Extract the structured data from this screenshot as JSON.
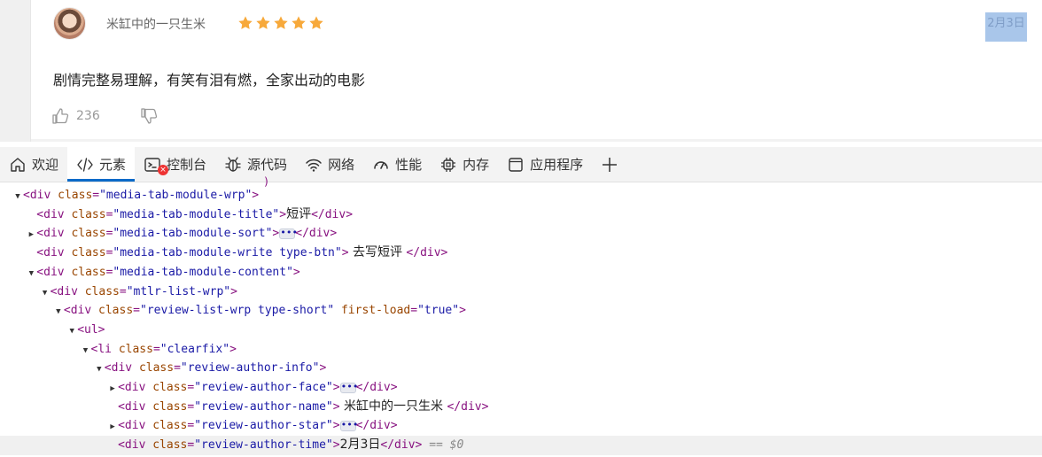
{
  "review": {
    "author_name": "米缸中的一只生米",
    "rating_stars": 5,
    "star_color": "#f7a93b",
    "date": "2月3日",
    "text": "剧情完整易理解，有笑有泪有燃，全家出动的电影",
    "like_count": "236"
  },
  "devtools": {
    "tabs": [
      {
        "label": "欢迎",
        "icon": "home-icon"
      },
      {
        "label": "元素",
        "icon": "code-icon",
        "active": true
      },
      {
        "label": "控制台",
        "icon": "console-icon",
        "badge": "x"
      },
      {
        "label": "源代码",
        "icon": "bug-icon"
      },
      {
        "label": "网络",
        "icon": "wifi-icon"
      },
      {
        "label": "性能",
        "icon": "gauge-icon"
      },
      {
        "label": "内存",
        "icon": "chip-icon"
      },
      {
        "label": "应用程序",
        "icon": "window-icon"
      }
    ],
    "add_tab_icon": "plus-icon",
    "accent_color": "#0b6ac8",
    "dom_lines": [
      {
        "indent": 0,
        "toggle": "open",
        "tag": "div",
        "attrs": [
          [
            "class",
            "media-tab-module-wrp"
          ]
        ],
        "close": false
      },
      {
        "indent": 1,
        "toggle": "",
        "tag": "div",
        "attrs": [
          [
            "class",
            "media-tab-module-title"
          ]
        ],
        "text": "短评",
        "close": true
      },
      {
        "indent": 1,
        "toggle": "closed",
        "tag": "div",
        "attrs": [
          [
            "class",
            "media-tab-module-sort"
          ]
        ],
        "ellipsis": true,
        "close": true
      },
      {
        "indent": 1,
        "toggle": "",
        "tag": "div",
        "attrs": [
          [
            "class",
            "media-tab-module-write type-btn"
          ]
        ],
        "text": " 去写短评 ",
        "close": true
      },
      {
        "indent": 1,
        "toggle": "open",
        "tag": "div",
        "attrs": [
          [
            "class",
            "media-tab-module-content"
          ]
        ],
        "close": false
      },
      {
        "indent": 2,
        "toggle": "open",
        "tag": "div",
        "attrs": [
          [
            "class",
            "mtlr-list-wrp"
          ]
        ],
        "close": false
      },
      {
        "indent": 3,
        "toggle": "open",
        "tag": "div",
        "attrs": [
          [
            "class",
            "review-list-wrp type-short"
          ],
          [
            "first-load",
            "true"
          ]
        ],
        "close": false
      },
      {
        "indent": 4,
        "toggle": "open",
        "tag": "ul",
        "attrs": [],
        "close": false
      },
      {
        "indent": 5,
        "toggle": "open",
        "tag": "li",
        "attrs": [
          [
            "class",
            "clearfix"
          ]
        ],
        "close": false
      },
      {
        "indent": 6,
        "toggle": "open",
        "tag": "div",
        "attrs": [
          [
            "class",
            "review-author-info"
          ]
        ],
        "close": false
      },
      {
        "indent": 7,
        "toggle": "closed",
        "tag": "div",
        "attrs": [
          [
            "class",
            "review-author-face"
          ]
        ],
        "ellipsis": true,
        "close": true
      },
      {
        "indent": 7,
        "toggle": "",
        "tag": "div",
        "attrs": [
          [
            "class",
            "review-author-name"
          ]
        ],
        "text": " 米缸中的一只生米 ",
        "close": true
      },
      {
        "indent": 7,
        "toggle": "closed",
        "tag": "div",
        "attrs": [
          [
            "class",
            "review-author-star"
          ]
        ],
        "ellipsis": true,
        "close": true
      },
      {
        "indent": 7,
        "toggle": "",
        "tag": "div",
        "attrs": [
          [
            "class",
            "review-author-time"
          ]
        ],
        "text": "2月3日",
        "close": true,
        "selected": true,
        "eq": "== $0"
      }
    ]
  }
}
